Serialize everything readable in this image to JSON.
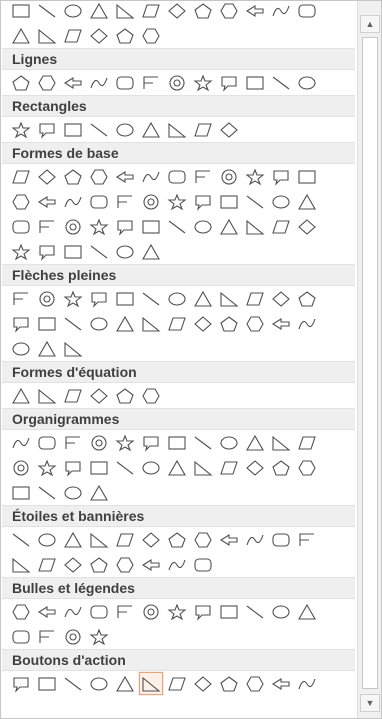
{
  "sections": [
    {
      "title": "",
      "rows": [
        12,
        6
      ]
    },
    {
      "title": "Lignes",
      "rows": [
        12
      ]
    },
    {
      "title": "Rectangles",
      "rows": [
        9
      ]
    },
    {
      "title": "Formes de base",
      "rows": [
        12,
        12,
        12,
        6
      ]
    },
    {
      "title": "Flèches pleines",
      "rows": [
        12,
        12,
        3
      ]
    },
    {
      "title": "Formes d'équation",
      "rows": [
        6
      ]
    },
    {
      "title": "Organigrammes",
      "rows": [
        12,
        12,
        4
      ]
    },
    {
      "title": "Étoiles et bannières",
      "rows": [
        12,
        8
      ]
    },
    {
      "title": "Bulles et légendes",
      "rows": [
        12,
        4
      ]
    },
    {
      "title": "Boutons d'action",
      "rows": [
        12
      ]
    }
  ],
  "selected_shape": {
    "section": 9,
    "row": 0,
    "index": 5
  },
  "scrollbar": {
    "up_icon": "▲",
    "down_icon": "▼"
  },
  "colors": {
    "stroke": "#505050",
    "header_bg": "#efefef",
    "selected_border": "#e8a27a"
  }
}
